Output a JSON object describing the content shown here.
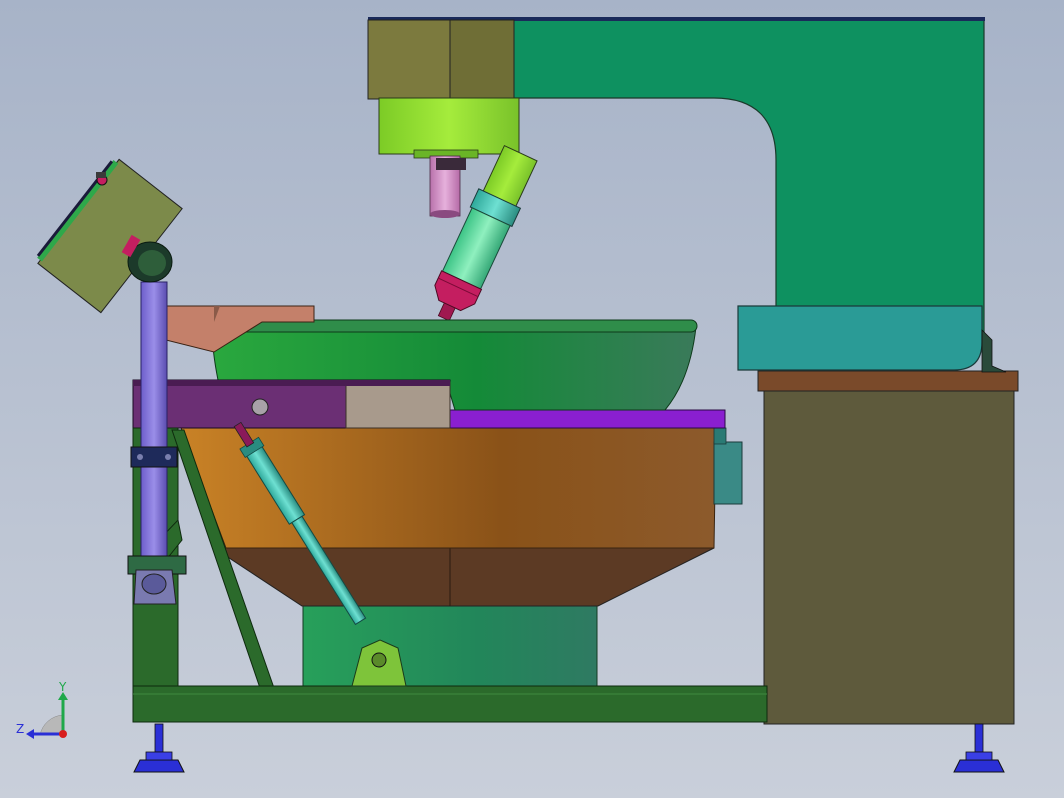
{
  "scene": {
    "background_top": "#a7b3c8",
    "background_bottom": "#c9cfda"
  },
  "triad": {
    "y_label": "Y",
    "z_label": "Z",
    "y_color": "#1fa84a",
    "z_color": "#2a2fd6",
    "x_color": "#d81d1d"
  },
  "colors": {
    "head_dark_olive": "#6f6e36",
    "head_light_olive": "#7c7a3e",
    "collar_green": "#8fdd2c",
    "arm_green": "#0e9160",
    "arm_teal_block": "#2a9b96",
    "cabinet_top": "#7a4a2a",
    "cabinet_body": "#5e5a3c",
    "bowl_green": "#1f9c3d",
    "bowl_rim": "#2f8d4a",
    "tray_purple": "#6b2f74",
    "plate_violet": "#8a1fd0",
    "drum_orange": "#c47a1f",
    "base_brown": "#5c3a24",
    "pedestal_green": "#2f9e5c",
    "frame_green": "#2b6a2b",
    "column_lavender": "#7a6bd8",
    "panel_olive": "#7c8a4a",
    "pink_sleeve": "#d089c4",
    "nozzle_crimson": "#c41e60",
    "nozzle_mint": "#5fdc9c",
    "cylinder_cyan": "#3fc2b4",
    "bracket_green": "#7ec43a",
    "foot_blue": "#2a2fd6",
    "chute_salmon": "#c4806a",
    "stepped_grey": "#a89a8c"
  }
}
